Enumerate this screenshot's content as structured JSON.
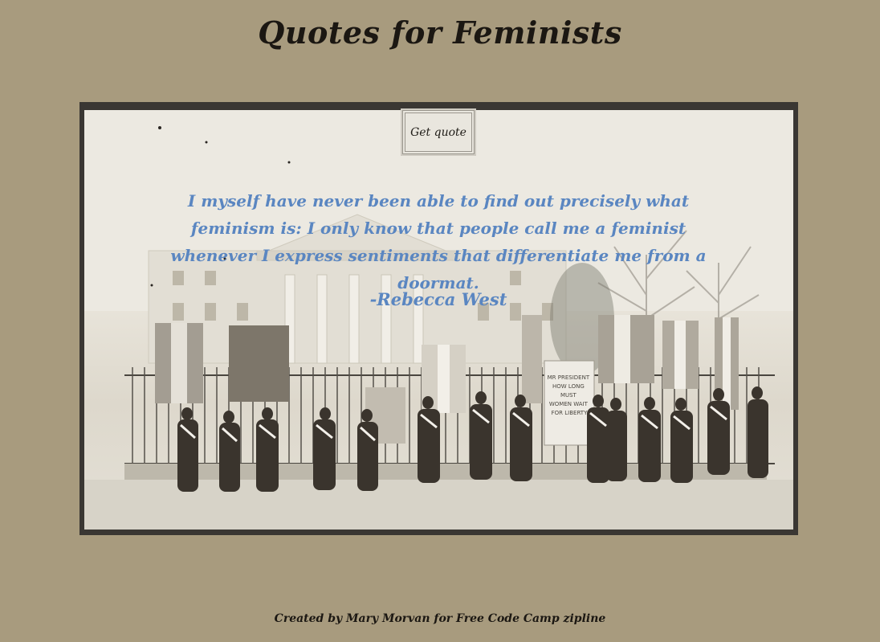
{
  "header": {
    "title": "Quotes for Feminists"
  },
  "photo": {
    "sign_text": "MR PRESIDENT HOW LONG MUST WOMEN WAIT FOR LIBERTY"
  },
  "controls": {
    "get_quote_label": "Get quote"
  },
  "quote": {
    "text": "I myself have never been able to find out precisely what feminism is: I only know that people call me a feminist whenever I express sentiments that differentiate me from a doormat.",
    "author": "-Rebecca West"
  },
  "footer": {
    "credit": "Created by Mary Morvan for Free Code Camp zipline"
  },
  "colors": {
    "background": "#a89b7e",
    "quote_text": "#5a86c1",
    "title_text": "#1b1712"
  }
}
